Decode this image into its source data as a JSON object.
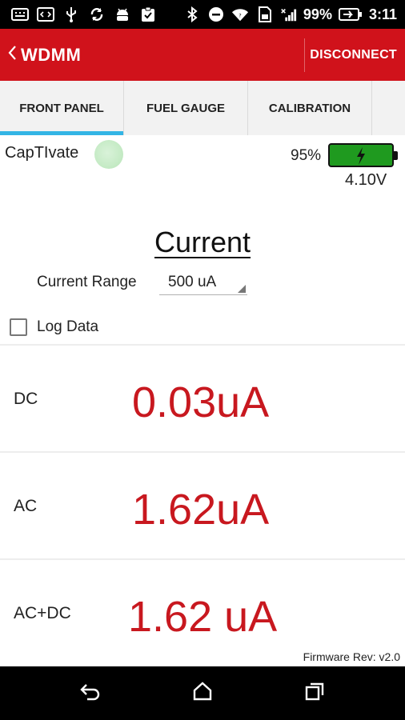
{
  "status_bar": {
    "battery_percent": "99%",
    "time": "3:11",
    "icons": [
      "keyboard-icon",
      "code-icon",
      "usb-icon",
      "sync-icon",
      "android-icon",
      "clipboard-icon",
      "bluetooth-icon",
      "do-not-disturb-icon",
      "wifi-icon",
      "sd-card-icon",
      "signal-icon",
      "battery-icon"
    ]
  },
  "app_bar": {
    "back_icon": "chevron-left-icon",
    "title": "WDMM",
    "action": "DISCONNECT",
    "color": "#d0121b"
  },
  "tabs": [
    {
      "label": "FRONT PANEL",
      "active": true
    },
    {
      "label": "FUEL GAUGE",
      "active": false
    },
    {
      "label": "CALIBRATION",
      "active": false
    },
    {
      "label": "",
      "active": false
    }
  ],
  "device": {
    "name": "CapTIvate",
    "battery_percent": "95%",
    "battery_level": 0.95,
    "battery_voltage": "4.10V"
  },
  "measurement": {
    "heading": "Current",
    "range_label": "Current Range",
    "range_value": "500 uA",
    "log_label": "Log Data",
    "log_checked": false
  },
  "readings": [
    {
      "label": "DC",
      "value": "0.03uA"
    },
    {
      "label": "AC",
      "value": "1.62uA"
    },
    {
      "label": "AC+DC",
      "value": "1.62 uA"
    }
  ],
  "footer": {
    "firmware": "Firmware Rev: v2.0"
  },
  "nav_bar": {
    "icons": [
      "back-icon",
      "home-icon",
      "recents-icon"
    ]
  },
  "colors": {
    "accent": "#33b5e5",
    "value": "#c8181f",
    "battery_fill": "#1f9a1f"
  }
}
